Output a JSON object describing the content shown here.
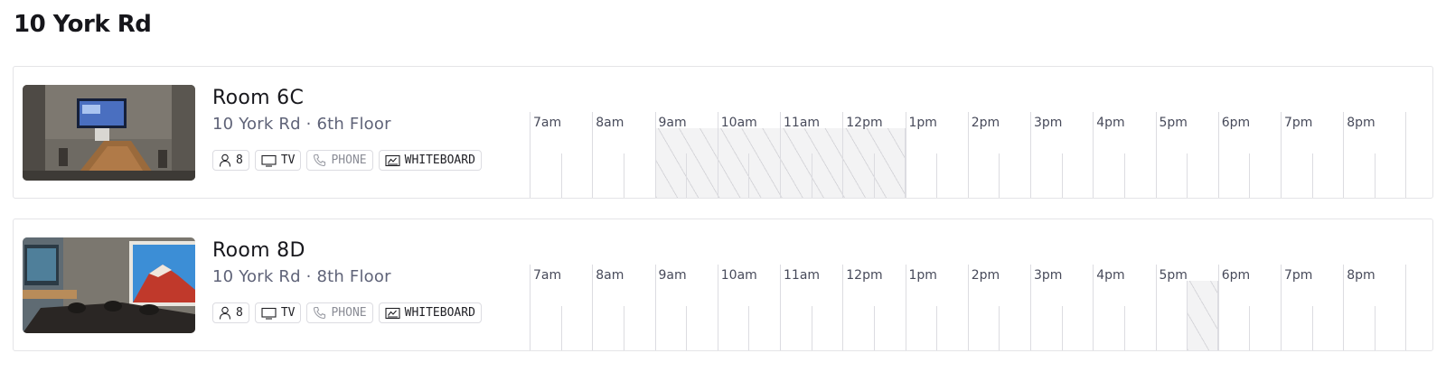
{
  "building": {
    "title": "10 York Rd"
  },
  "rooms": [
    {
      "name": "Room 6C",
      "location": "10 York Rd · 6th Floor",
      "amenities": {
        "capacity": "8",
        "tv": "TV",
        "phone": "PHONE",
        "whiteboard": "WHITEBOARD"
      },
      "hours": [
        "7am",
        "8am",
        "9am",
        "10am",
        "11am",
        "12pm",
        "1pm",
        "2pm",
        "3pm",
        "4pm",
        "5pm",
        "6pm",
        "7pm",
        "8pm"
      ],
      "booked": [
        {
          "start": "9am",
          "end": "1pm"
        }
      ]
    },
    {
      "name": "Room 8D",
      "location": "10 York Rd · 8th Floor",
      "amenities": {
        "capacity": "8",
        "tv": "TV",
        "phone": "PHONE",
        "whiteboard": "WHITEBOARD"
      },
      "hours": [
        "7am",
        "8am",
        "9am",
        "10am",
        "11am",
        "12pm",
        "1pm",
        "2pm",
        "3pm",
        "4pm",
        "5pm",
        "6pm",
        "7pm",
        "8pm"
      ],
      "booked": [
        {
          "start": "5:30pm",
          "end": "6pm"
        }
      ]
    }
  ],
  "icons": {
    "capacity": "person-icon",
    "tv": "tv-icon",
    "phone": "phone-icon",
    "whiteboard": "whiteboard-icon"
  },
  "colors": {
    "busy_fill": "#f3f3f4",
    "busy_stripe": "#cdcdd2",
    "grid_line": "#dcdce1",
    "location_text": "#5f6378"
  }
}
